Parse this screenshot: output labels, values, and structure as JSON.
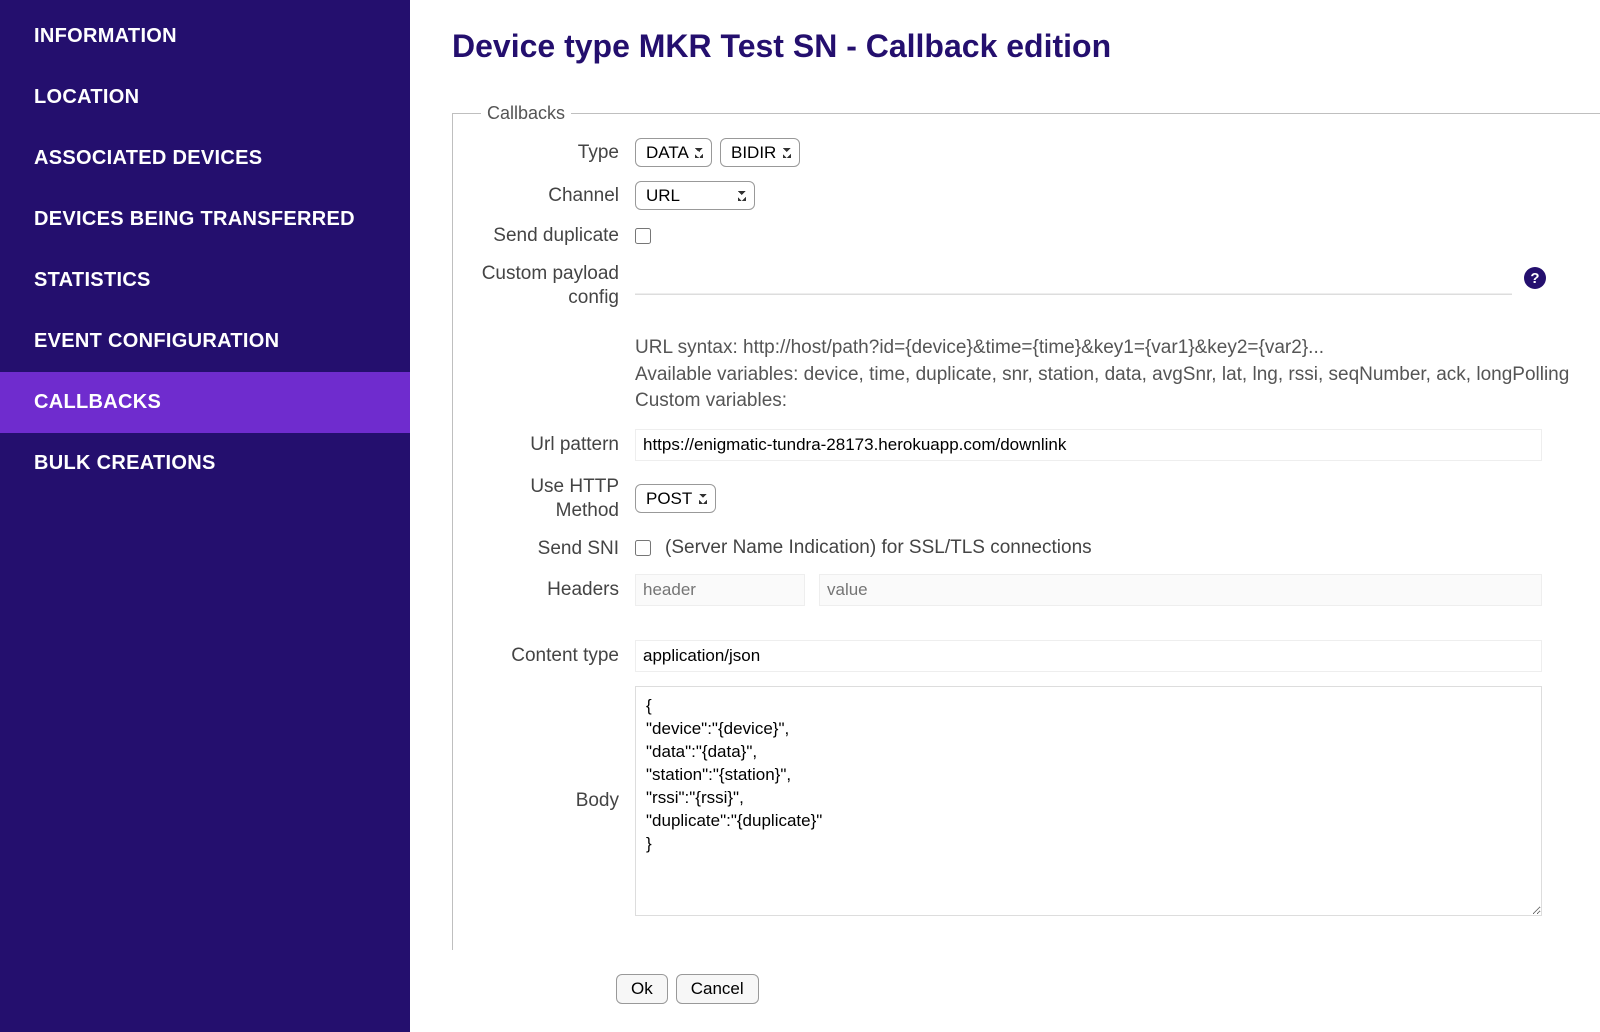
{
  "sidebar": {
    "items": [
      {
        "label": "INFORMATION",
        "active": false
      },
      {
        "label": "LOCATION",
        "active": false
      },
      {
        "label": "ASSOCIATED DEVICES",
        "active": false
      },
      {
        "label": "DEVICES BEING TRANSFERRED",
        "active": false
      },
      {
        "label": "STATISTICS",
        "active": false
      },
      {
        "label": "EVENT CONFIGURATION",
        "active": false
      },
      {
        "label": "CALLBACKS",
        "active": true
      },
      {
        "label": "BULK CREATIONS",
        "active": false
      }
    ]
  },
  "page": {
    "title": "Device type MKR Test SN - Callback edition"
  },
  "fieldset": {
    "legend": "Callbacks"
  },
  "form": {
    "type_label": "Type",
    "type_value": "DATA",
    "type_sub_value": "BIDIR",
    "channel_label": "Channel",
    "channel_value": "URL",
    "send_duplicate_label": "Send duplicate",
    "custom_payload_label": "Custom payload config",
    "help_icon_glyph": "?",
    "hint_line1": "URL syntax: http://host/path?id={device}&time={time}&key1={var1}&key2={var2}...",
    "hint_line2": "Available variables: device, time, duplicate, snr, station, data, avgSnr, lat, lng, rssi, seqNumber, ack, longPolling",
    "hint_line3": "Custom variables:",
    "url_pattern_label": "Url pattern",
    "url_pattern_value": "https://enigmatic-tundra-28173.herokuapp.com/downlink",
    "http_method_label": "Use HTTP Method",
    "http_method_value": "POST",
    "send_sni_label": "Send SNI",
    "send_sni_text": "(Server Name Indication) for SSL/TLS connections",
    "headers_label": "Headers",
    "headers_key_placeholder": "header",
    "headers_val_placeholder": "value",
    "content_type_label": "Content type",
    "content_type_value": "application/json",
    "body_label": "Body",
    "body_value": "{\n\"device\":\"{device}\",\n\"data\":\"{data}\",\n\"station\":\"{station}\",\n\"rssi\":\"{rssi}\",\n\"duplicate\":\"{duplicate}\"\n}"
  },
  "buttons": {
    "ok": "Ok",
    "cancel": "Cancel"
  }
}
